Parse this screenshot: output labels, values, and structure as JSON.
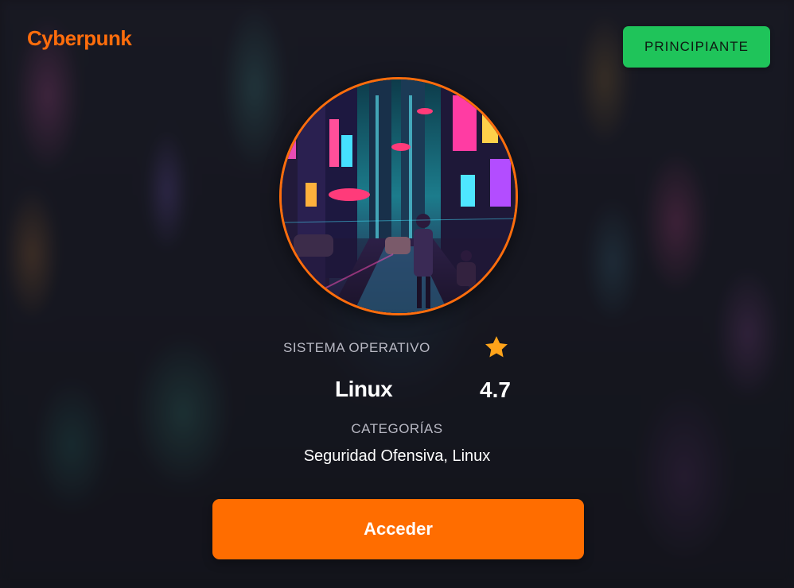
{
  "brand": {
    "title": "Cyberpunk",
    "color": "#ff6d0c"
  },
  "badge": {
    "level": "PRINCIPIANTE",
    "color": "#1fc45a"
  },
  "course": {
    "os_label": "SISTEMA OPERATIVO",
    "os_value": "Linux",
    "rating_icon": "star-icon",
    "rating": "4.7",
    "categories_label": "CATEGORÍAS",
    "categories_value": "Seguridad Ofensiva, Linux"
  },
  "actions": {
    "access_label": "Acceder",
    "accent_color": "#ff6d00"
  }
}
